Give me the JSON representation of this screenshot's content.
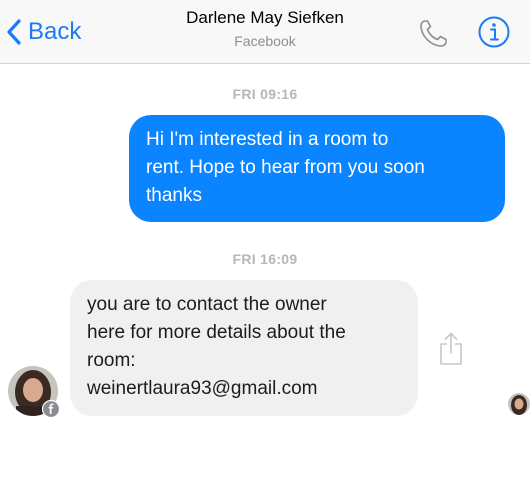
{
  "nav": {
    "back_label": "Back",
    "contact_name": "Darlene May Siefken",
    "contact_source": "Facebook",
    "icons": {
      "back": "chevron-left-icon",
      "call": "phone-icon",
      "info": "info-icon"
    }
  },
  "conversation": {
    "messages": [
      {
        "timestamp": "FRI 09:16",
        "direction": "outgoing",
        "lines": [
          "Hi I'm interested in a room to",
          "rent. Hope to hear from you soon",
          "thanks"
        ]
      },
      {
        "timestamp": "FRI 16:09",
        "direction": "incoming",
        "lines": [
          "you are to contact the owner",
          "here for more details about the",
          "room:",
          "weinertlaura93@gmail.com"
        ]
      }
    ],
    "share_icon": "share-icon",
    "sender_avatar_badge": "facebook-icon"
  },
  "colors": {
    "accent": "#1a7cf5",
    "outgoing_bubble": "#0b84ff",
    "incoming_bubble": "#f0f0f0",
    "timestamp": "#b6b6bb",
    "nav_background": "#f8f8f8"
  }
}
